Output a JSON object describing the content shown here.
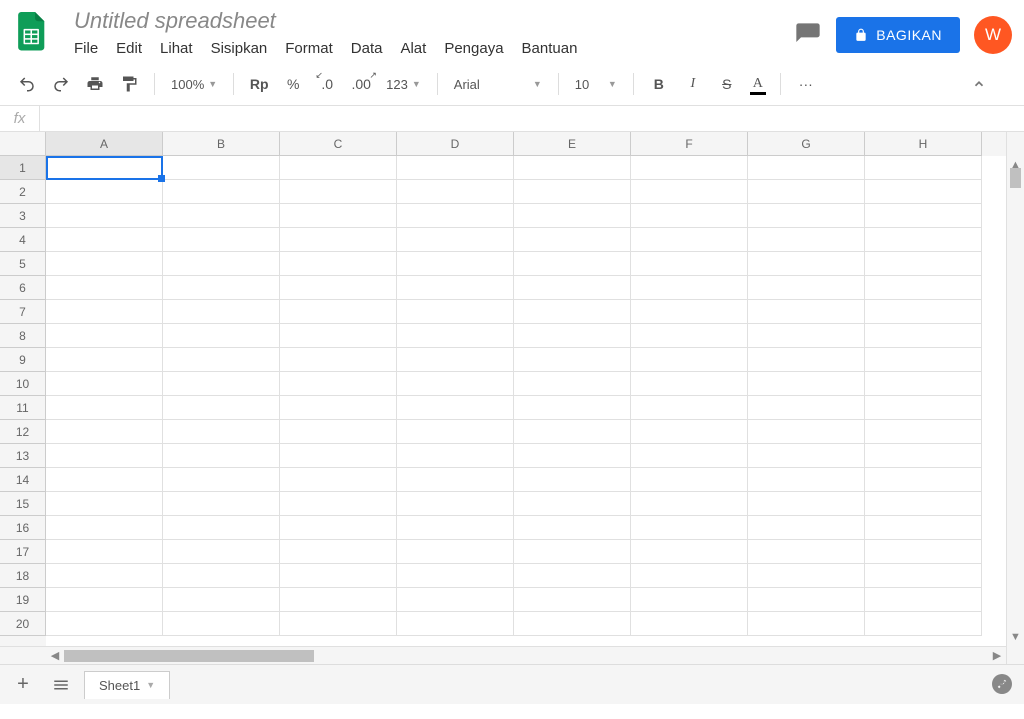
{
  "header": {
    "doc_title": "Untitled spreadsheet",
    "menu": [
      "File",
      "Edit",
      "Lihat",
      "Sisipkan",
      "Format",
      "Data",
      "Alat",
      "Pengaya",
      "Bantuan"
    ],
    "share_label": "BAGIKAN",
    "avatar_letter": "W"
  },
  "toolbar": {
    "zoom": "100%",
    "currency": "Rp",
    "percent": "%",
    "dec_dec": ".0",
    "inc_dec": ".00",
    "format_123": "123",
    "font": "Arial",
    "font_size": "10",
    "more": "···"
  },
  "formula": {
    "fx": "fx",
    "value": ""
  },
  "grid": {
    "columns": [
      "A",
      "B",
      "C",
      "D",
      "E",
      "F",
      "G",
      "H"
    ],
    "rows": [
      1,
      2,
      3,
      4,
      5,
      6,
      7,
      8,
      9,
      10,
      11,
      12,
      13,
      14,
      15,
      16,
      17,
      18,
      19,
      20
    ],
    "selected_cell": "A1"
  },
  "sheets": {
    "active": "Sheet1"
  }
}
